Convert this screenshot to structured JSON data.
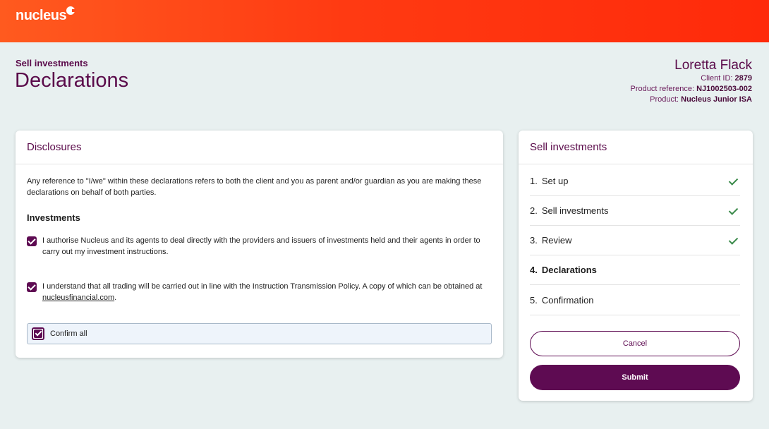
{
  "header": {
    "logo": "nucleus"
  },
  "page": {
    "breadcrumb": "Sell investments",
    "title": "Declarations"
  },
  "client": {
    "name": "Loretta Flack",
    "id_label": "Client ID:",
    "id_value": "2879",
    "ref_label": "Product reference:",
    "ref_value": "NJ1002503-002",
    "product_label": "Product:",
    "product_value": "Nucleus Junior ISA"
  },
  "disclosures": {
    "title": "Disclosures",
    "intro": "Any reference to \"I/we\" within these declarations refers to both the client and you as parent and/or guardian as you are making these declarations on behalf of both parties.",
    "section": "Investments",
    "decl1": "I authorise Nucleus and its agents to deal directly with the providers and issuers of investments held and their agents in order to carry out my investment instructions.",
    "decl2_pre": "I understand that all trading will be carried out in line with the Instruction Transmission Policy. A copy of which can be obtained at ",
    "decl2_link": "nucleusfinancial.com",
    "decl2_post": ".",
    "confirm_all": "Confirm all"
  },
  "steps": {
    "title": "Sell investments",
    "items": [
      {
        "num": "1.",
        "label": "Set up",
        "done": true
      },
      {
        "num": "2.",
        "label": "Sell investments",
        "done": true
      },
      {
        "num": "3.",
        "label": "Review",
        "done": true
      },
      {
        "num": "4.",
        "label": "Declarations",
        "done": false
      },
      {
        "num": "5.",
        "label": "Confirmation",
        "done": false
      }
    ],
    "cancel": "Cancel",
    "submit": "Submit"
  }
}
